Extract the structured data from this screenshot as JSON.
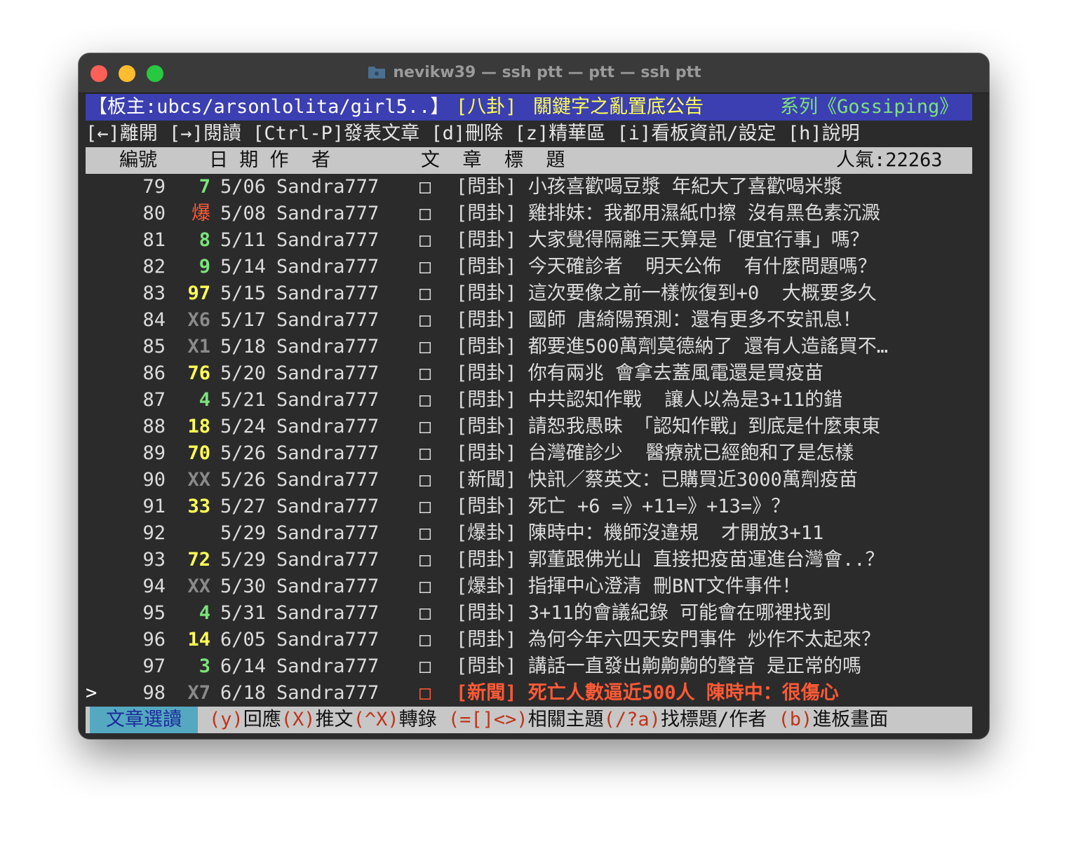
{
  "window": {
    "title": "nevikw39 — ssh ptt — ptt — ssh ptt",
    "folder_icon": "folder-icon"
  },
  "header": {
    "moderators": "【板主:ubcs/arsonlolita/girl5..】",
    "board_name": "[八卦]",
    "announcement": "關鍵字之亂置底公告",
    "series": "系列《Gossiping》"
  },
  "menu": {
    "items": [
      {
        "key": "[←]",
        "label": "離開"
      },
      {
        "key": "[→]",
        "label": "閱讀"
      },
      {
        "key": "[Ctrl-P]",
        "label": "發表文章"
      },
      {
        "key": "[d]",
        "label": "刪除"
      },
      {
        "key": "[z]",
        "label": "精華區"
      },
      {
        "key": "[i]",
        "label": "看板資訊/設定"
      },
      {
        "key": "[h]",
        "label": "說明"
      }
    ]
  },
  "columns": {
    "num": "編號",
    "date_author": "日 期 作  者",
    "title": "文  章  標  題",
    "popularity": "人氣:22263"
  },
  "articles": [
    {
      "cursor": "",
      "num": "79",
      "rec": "7",
      "rec_color": "green",
      "date": "5/06",
      "author": "Sandra777",
      "mark": "□",
      "title": "[問卦] 小孩喜歡喝豆漿 年紀大了喜歡喝米漿",
      "selected": false
    },
    {
      "cursor": "",
      "num": "80",
      "rec": "爆",
      "rec_color": "red",
      "date": "5/08",
      "author": "Sandra777",
      "mark": "□",
      "title": "[問卦] 雞排妹：我都用濕紙巾擦 沒有黑色素沉澱",
      "selected": false
    },
    {
      "cursor": "",
      "num": "81",
      "rec": "8",
      "rec_color": "green",
      "date": "5/11",
      "author": "Sandra777",
      "mark": "□",
      "title": "[問卦] 大家覺得隔離三天算是「便宜行事」嗎？",
      "selected": false
    },
    {
      "cursor": "",
      "num": "82",
      "rec": "9",
      "rec_color": "green",
      "date": "5/14",
      "author": "Sandra777",
      "mark": "□",
      "title": "[問卦] 今天確診者  明天公佈  有什麼問題嗎？",
      "selected": false
    },
    {
      "cursor": "",
      "num": "83",
      "rec": "97",
      "rec_color": "yellow",
      "date": "5/15",
      "author": "Sandra777",
      "mark": "□",
      "title": "[問卦] 這次要像之前一樣恢復到+0  大概要多久",
      "selected": false
    },
    {
      "cursor": "",
      "num": "84",
      "rec": "X6",
      "rec_color": "gray",
      "date": "5/17",
      "author": "Sandra777",
      "mark": "□",
      "title": "[問卦] 國師 唐綺陽預測：還有更多不安訊息！",
      "selected": false
    },
    {
      "cursor": "",
      "num": "85",
      "rec": "X1",
      "rec_color": "gray",
      "date": "5/18",
      "author": "Sandra777",
      "mark": "□",
      "title": "[問卦] 都要進500萬劑莫德納了 還有人造謠買不…",
      "selected": false
    },
    {
      "cursor": "",
      "num": "86",
      "rec": "76",
      "rec_color": "yellow",
      "date": "5/20",
      "author": "Sandra777",
      "mark": "□",
      "title": "[問卦] 你有兩兆 會拿去蓋風電還是買疫苗",
      "selected": false
    },
    {
      "cursor": "",
      "num": "87",
      "rec": "4",
      "rec_color": "green",
      "date": "5/21",
      "author": "Sandra777",
      "mark": "□",
      "title": "[問卦] 中共認知作戰  讓人以為是3+11的錯",
      "selected": false
    },
    {
      "cursor": "",
      "num": "88",
      "rec": "18",
      "rec_color": "yellow",
      "date": "5/24",
      "author": "Sandra777",
      "mark": "□",
      "title": "[問卦] 請恕我愚昧 「認知作戰」到底是什麼東東",
      "selected": false
    },
    {
      "cursor": "",
      "num": "89",
      "rec": "70",
      "rec_color": "yellow",
      "date": "5/26",
      "author": "Sandra777",
      "mark": "□",
      "title": "[問卦] 台灣確診少  醫療就已經飽和了是怎樣",
      "selected": false
    },
    {
      "cursor": "",
      "num": "90",
      "rec": "XX",
      "rec_color": "gray",
      "date": "5/26",
      "author": "Sandra777",
      "mark": "□",
      "title": "[新聞] 快訊／蔡英文：已購買近3000萬劑疫苗",
      "selected": false
    },
    {
      "cursor": "",
      "num": "91",
      "rec": "33",
      "rec_color": "yellow",
      "date": "5/27",
      "author": "Sandra777",
      "mark": "□",
      "title": "[問卦] 死亡 +6 =》+11=》+13=》？",
      "selected": false
    },
    {
      "cursor": "",
      "num": "92",
      "rec": "",
      "rec_color": "gray",
      "date": "5/29",
      "author": "Sandra777",
      "mark": "□",
      "title": "[爆卦] 陳時中：機師沒違規  才開放3+11",
      "selected": false
    },
    {
      "cursor": "",
      "num": "93",
      "rec": "72",
      "rec_color": "yellow",
      "date": "5/29",
      "author": "Sandra777",
      "mark": "□",
      "title": "[問卦] 郭董跟佛光山 直接把疫苗運進台灣會..？",
      "selected": false
    },
    {
      "cursor": "",
      "num": "94",
      "rec": "XX",
      "rec_color": "gray",
      "date": "5/30",
      "author": "Sandra777",
      "mark": "□",
      "title": "[爆卦] 指揮中心澄清 刪BNT文件事件！",
      "selected": false
    },
    {
      "cursor": "",
      "num": "95",
      "rec": "4",
      "rec_color": "green",
      "date": "5/31",
      "author": "Sandra777",
      "mark": "□",
      "title": "[問卦] 3+11的會議紀錄 可能會在哪裡找到",
      "selected": false
    },
    {
      "cursor": "",
      "num": "96",
      "rec": "14",
      "rec_color": "yellow",
      "date": "6/05",
      "author": "Sandra777",
      "mark": "□",
      "title": "[問卦] 為何今年六四天安門事件 炒作不太起來？",
      "selected": false
    },
    {
      "cursor": "",
      "num": "97",
      "rec": "3",
      "rec_color": "green",
      "date": "6/14",
      "author": "Sandra777",
      "mark": "□",
      "title": "[問卦] 講話一直發出齁齁齁的聲音 是正常的嗎",
      "selected": false
    },
    {
      "cursor": ">",
      "num": "98",
      "rec": "X7",
      "rec_color": "gray",
      "date": "6/18",
      "author": "Sandra777",
      "mark": "□",
      "title": "[新聞] 死亡人數逼近500人 陳時中：很傷心",
      "selected": true
    }
  ],
  "status": {
    "mode": "文章選讀",
    "hints": [
      {
        "key": "(y)",
        "label": "回應"
      },
      {
        "key": "(X)",
        "label": "推文"
      },
      {
        "key": "(^X)",
        "label": "轉錄"
      },
      {
        "key": "(=[]<>)",
        "label": "相關主題"
      },
      {
        "key": "(/?a)",
        "label": "找標題/作者"
      },
      {
        "key": "(b)",
        "label": "進板畫面"
      }
    ]
  },
  "colors": {
    "header_bg": "#3b3fb1",
    "rec_green": "#7ce27c",
    "rec_yellow": "#ffff55",
    "rec_red": "#ff5a36",
    "rec_gray": "#8a8a8a",
    "selected_title": "#ff5a36",
    "status_mode_bg": "#54a8c0"
  }
}
